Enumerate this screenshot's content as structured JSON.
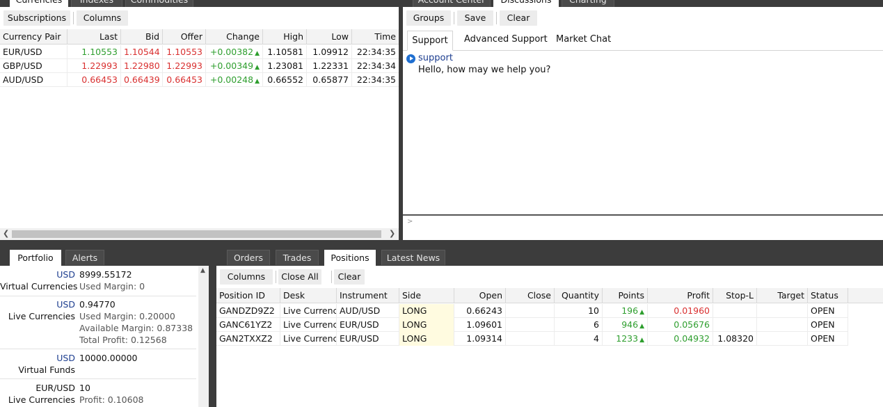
{
  "left_top": {
    "tabs": [
      "Currencies",
      "Indexes",
      "Commodities"
    ],
    "toolbar": {
      "subscriptions": "Subscriptions",
      "columns": "Columns"
    },
    "columns": [
      "Currency Pair",
      "Last",
      "Bid",
      "Offer",
      "Change",
      "High",
      "Low",
      "Time"
    ],
    "rows": [
      {
        "pair": "EUR/USD",
        "last": "1.10553",
        "bid": "1.10544",
        "offer": "1.10553",
        "change": "+0.00382",
        "high": "1.10581",
        "low": "1.09912",
        "time": "22:34:35"
      },
      {
        "pair": "GBP/USD",
        "last": "1.22993",
        "bid": "1.22980",
        "offer": "1.22993",
        "change": "+0.00349",
        "high": "1.23081",
        "low": "1.22331",
        "time": "22:34:34"
      },
      {
        "pair": "AUD/USD",
        "last": "0.66453",
        "bid": "0.66439",
        "offer": "0.66453",
        "change": "+0.00248",
        "high": "0.66552",
        "low": "0.65877",
        "time": "22:34:35"
      }
    ]
  },
  "right_top": {
    "tabs": [
      "Account Center",
      "Discussions",
      "Charting"
    ],
    "toolbar": {
      "groups": "Groups",
      "save": "Save",
      "clear": "Clear"
    },
    "subtabs": [
      "Support",
      "Advanced Support",
      "Market Chat"
    ],
    "chat": {
      "sender": "support",
      "message": "Hello, how may we help you?",
      "input_prompt": ">"
    }
  },
  "portfolio": {
    "tabs": [
      "Portfolio",
      "Alerts"
    ],
    "sections": [
      {
        "currency": "USD",
        "value": "8999.55172",
        "label": "Virtual Currencies",
        "details": [
          "Used Margin:  0"
        ]
      },
      {
        "currency": "USD",
        "value": "0.94770",
        "label": "Live Currencies",
        "details": [
          "Used Margin:  0.20000",
          "Available Margin:  0.87338",
          "Total Profit:  0.12568"
        ]
      },
      {
        "currency": "USD",
        "value": "10000.00000",
        "label": "Virtual Funds",
        "details": []
      },
      {
        "currency": "EUR/USD",
        "value": "10",
        "label": "Live Currencies",
        "details": [
          "Profit:  0.10608"
        ]
      }
    ]
  },
  "positions": {
    "tabs": [
      "Orders",
      "Trades",
      "Positions",
      "Latest News"
    ],
    "toolbar": {
      "columns": "Columns",
      "close_all": "Close All",
      "clear": "Clear"
    },
    "columns": [
      "Position ID",
      "Desk",
      "Instrument",
      "Side",
      "Open",
      "Close",
      "Quantity",
      "Points",
      "Profit",
      "Stop-L",
      "Target",
      "Status"
    ],
    "rows": [
      {
        "id": "GANDZD9Z2",
        "desk": "Live Currencies",
        "instrument": "AUD/USD",
        "side": "LONG",
        "open": "0.66243",
        "close": "",
        "quantity": "10",
        "points": "196",
        "profit": "0.01960",
        "stop": "",
        "target": "",
        "status": "OPEN"
      },
      {
        "id": "GANC61YZ2",
        "desk": "Live Currencies",
        "instrument": "EUR/USD",
        "side": "LONG",
        "open": "1.09601",
        "close": "",
        "quantity": "6",
        "points": "946",
        "profit": "0.05676",
        "stop": "",
        "target": "",
        "status": "OPEN"
      },
      {
        "id": "GAN2TXXZ2",
        "desk": "Live Currencies",
        "instrument": "EUR/USD",
        "side": "LONG",
        "open": "1.09314",
        "close": "",
        "quantity": "4",
        "points": "1233",
        "profit": "0.04932",
        "stop": "1.08320",
        "target": "",
        "status": "OPEN"
      }
    ]
  },
  "colors": {
    "positive": "#2e9e2e",
    "negative": "#d93030",
    "accent": "#1c3d8f"
  }
}
